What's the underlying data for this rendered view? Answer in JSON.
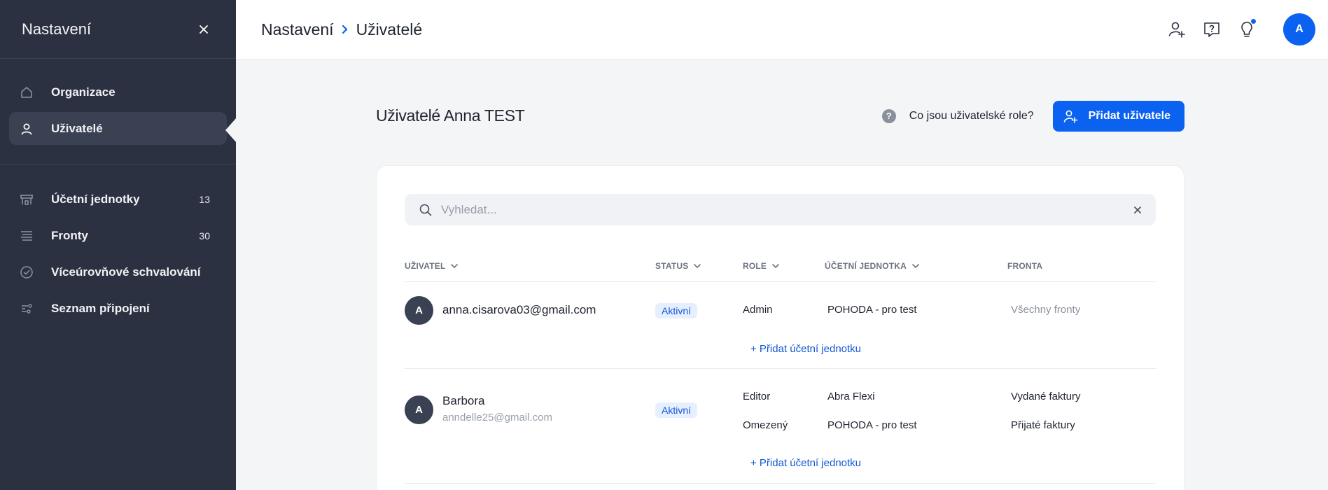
{
  "sidebar": {
    "title": "Nastavení",
    "items_top": [
      {
        "label": "Organizace",
        "icon": "home-icon"
      },
      {
        "label": "Uživatelé",
        "icon": "user-icon",
        "active": true
      }
    ],
    "items_bottom": [
      {
        "label": "Účetní jednotky",
        "count": "13",
        "icon": "building-icon"
      },
      {
        "label": "Fronty",
        "count": "30",
        "icon": "lines-icon"
      },
      {
        "label": "Víceúrovňové schvalování",
        "icon": "check-circle-icon"
      },
      {
        "label": "Seznam připojení",
        "icon": "connections-icon"
      }
    ]
  },
  "topbar": {
    "breadcrumb": [
      "Nastavení",
      "Uživatelé"
    ],
    "avatar_letter": "A"
  },
  "main": {
    "title": "Uživatelé Anna TEST",
    "help_link": "Co jsou uživatelské role?",
    "help_mark": "?",
    "add_button": "Přidat uživatele"
  },
  "search": {
    "placeholder": "Vyhledat..."
  },
  "table": {
    "headers": {
      "user": "UŽIVATEL",
      "status": "STATUS",
      "role": "ROLE",
      "unit": "ÚČETNÍ JEDNOTKA",
      "queue": "FRONTA"
    },
    "add_unit_label": "+ Přidat účetní jednotku",
    "rows": [
      {
        "avatar": "A",
        "email": "anna.cisarova03@gmail.com",
        "status": "Aktivní",
        "assignments": [
          {
            "role": "Admin",
            "unit": "POHODA - pro test",
            "queue": "Všechny fronty"
          }
        ]
      },
      {
        "avatar": "A",
        "name": "Barbora",
        "email": "anndelle25@gmail.com",
        "status": "Aktivní",
        "assignments": [
          {
            "role": "Editor",
            "unit": "Abra Flexi",
            "queue": "Vydané faktury"
          },
          {
            "role": "Omezený",
            "unit": "POHODA - pro test",
            "queue": "Přijaté faktury"
          }
        ]
      }
    ]
  },
  "colors": {
    "sidebar_bg": "#2b3140",
    "accent": "#0b61f0",
    "badge_bg": "#e6efff"
  }
}
